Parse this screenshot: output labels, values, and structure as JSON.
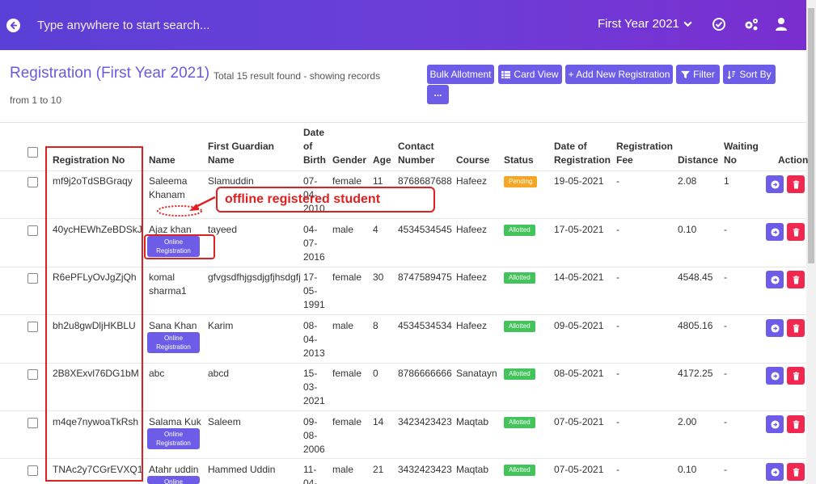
{
  "topbar": {
    "search_placeholder": "Type anywhere to start search...",
    "year_selected": "First Year 2021",
    "icons": [
      "back-arrow-icon",
      "chevron-down-icon",
      "check-circle-icon",
      "cogs-icon",
      "user-icon"
    ]
  },
  "page": {
    "title": "Registration (First Year 2021)",
    "summary": "Total 15 result found - showing records",
    "range": "from 1 to 10"
  },
  "toolbar": {
    "bulk_allotment": "Bulk Allotment",
    "card_view": "Card View",
    "add_new": "+ Add New Registration",
    "filter": "Filter",
    "sort_by": "Sort By",
    "more": "..."
  },
  "table": {
    "headers": {
      "registration_no": "Registration No",
      "name": "Name",
      "guardian": "First Guardian Name",
      "dob": "Date of Birth",
      "gender": "Gender",
      "age": "Age",
      "contact": "Contact Number",
      "course": "Course",
      "status": "Status",
      "date_of_registration": "Date of Registration",
      "fee": "Registration Fee",
      "distance": "Distance",
      "waiting": "Waiting No",
      "action": "Action"
    },
    "online_label": "Online Registration",
    "rows": [
      {
        "reg": "mf9j2oTdSBGraqy",
        "name": "Saleema Khanam",
        "online": false,
        "guardian": "Slamuddin",
        "dob": "07-04-2010",
        "gender": "female",
        "age": "11",
        "contact": "8768687688",
        "course": "Hafeez",
        "status": "Pending",
        "date": "19-05-2021",
        "fee": "-",
        "distance": "2.08",
        "waiting": "1"
      },
      {
        "reg": "40ycHEWhZeBDSkJ",
        "name": "Ajaz khan",
        "online": true,
        "guardian": "tayeed",
        "dob": "04-07-2016",
        "gender": "male",
        "age": "4",
        "contact": "4534534545",
        "course": "Hafeez",
        "status": "Allotted",
        "date": "17-05-2021",
        "fee": "-",
        "distance": "0.10",
        "waiting": "-"
      },
      {
        "reg": "R6ePFLyOvJgZjQh",
        "name": "komal sharma1",
        "online": false,
        "guardian": "gfvgsdfhjgsdjgfjhsdgfj",
        "dob": "17-05-1991",
        "gender": "female",
        "age": "30",
        "contact": "8747589475",
        "course": "Hafeez",
        "status": "Allotted",
        "date": "14-05-2021",
        "fee": "-",
        "distance": "4548.45",
        "waiting": "-"
      },
      {
        "reg": "bh2u8gwDljHKBLU",
        "name": "Sana Khan",
        "online": true,
        "guardian": "Karim",
        "dob": "08-04-2013",
        "gender": "male",
        "age": "8",
        "contact": "4534534534",
        "course": "Hafeez",
        "status": "Allotted",
        "date": "09-05-2021",
        "fee": "-",
        "distance": "4805.16",
        "waiting": "-"
      },
      {
        "reg": "2B8XExvl76DG1bM",
        "name": "abc",
        "online": false,
        "guardian": "abcd",
        "dob": "15-03-2021",
        "gender": "female",
        "age": "0",
        "contact": "8786666666",
        "course": "Sanatayn",
        "status": "Allotted",
        "date": "08-05-2021",
        "fee": "-",
        "distance": "4172.25",
        "waiting": "-"
      },
      {
        "reg": "m4qe7nywoaTkRsh",
        "name": "Salama Kuk",
        "online": true,
        "guardian": "Saleem",
        "dob": "09-08-2006",
        "gender": "female",
        "age": "14",
        "contact": "3423423423",
        "course": "Maqtab",
        "status": "Allotted",
        "date": "07-05-2021",
        "fee": "-",
        "distance": "2.00",
        "waiting": "-"
      },
      {
        "reg": "TNAc2y7CGrEVXQ1",
        "name": "Atahr uddin",
        "online": true,
        "guardian": "Hammed Uddin",
        "dob": "11-04-",
        "gender": "male",
        "age": "21",
        "contact": "3432423423",
        "course": "Maqtab",
        "status": "Allotted",
        "date": "07-05-2021",
        "fee": "-",
        "distance": "0.10",
        "waiting": "-"
      }
    ]
  },
  "annotation": {
    "callout": "offline registered student",
    "color": "#e02020"
  },
  "colors": {
    "accent": "#6c5ce7",
    "allotted": "#43c45a",
    "pending": "#f5a623",
    "delete": "#f0274f"
  }
}
